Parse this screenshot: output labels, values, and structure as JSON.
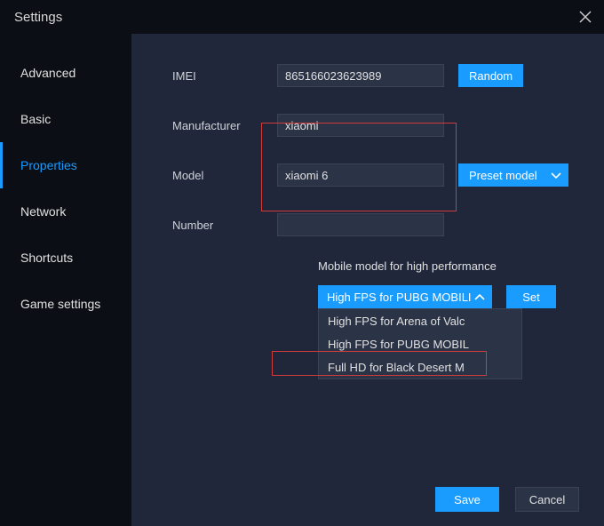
{
  "window": {
    "title": "Settings"
  },
  "sidebar": {
    "items": [
      {
        "label": "Advanced"
      },
      {
        "label": "Basic"
      },
      {
        "label": "Properties"
      },
      {
        "label": "Network"
      },
      {
        "label": "Shortcuts"
      },
      {
        "label": "Game settings"
      }
    ],
    "active_index": 2
  },
  "form": {
    "imei": {
      "label": "IMEI",
      "value": "865166023623989",
      "random_label": "Random"
    },
    "manufacturer": {
      "label": "Manufacturer",
      "value": "xiaomi"
    },
    "model": {
      "label": "Model",
      "value": "xiaomi 6",
      "preset_label": "Preset model"
    },
    "number": {
      "label": "Number",
      "value": ""
    }
  },
  "performance": {
    "heading": "Mobile model for high performance",
    "selected": "High FPS for PUBG MOBILI",
    "set_label": "Set",
    "options": [
      "High FPS for Arena of Valc",
      "High FPS for PUBG MOBIL",
      "Full HD for Black Desert M"
    ]
  },
  "footer": {
    "save": "Save",
    "cancel": "Cancel"
  }
}
